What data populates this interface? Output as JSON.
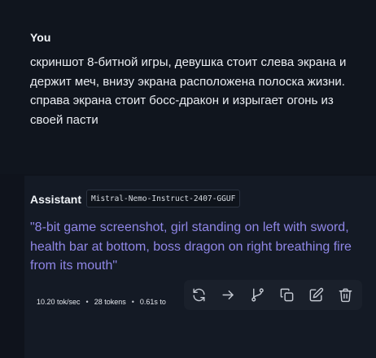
{
  "user": {
    "name": "You",
    "message": "скриншот 8-битной игры, девушка стоит слева экрана и держит меч, внизу экрана расположена полоска жизни. справа экрана стоит босс-дракон и изрыгает огонь из своей пасти"
  },
  "assistant": {
    "name": "Assistant",
    "model": "Mistral-Nemo-Instruct-2407-GGUF",
    "message": "\"8-bit game screenshot, girl standing on left with sword, health bar at bottom, boss dragon on right breathing fire from its mouth\""
  },
  "stats": {
    "speed": "10.20 tok/sec",
    "tokens": "28 tokens",
    "time": "0.61s to"
  },
  "toolbar": {
    "icons": [
      "regenerate-icon",
      "continue-icon",
      "branch-icon",
      "copy-icon",
      "edit-icon",
      "delete-icon"
    ]
  },
  "colors": {
    "background": "#0f131c",
    "assistant_panel": "#141a25",
    "assistant_text": "#8f86e6",
    "toolbar": "#1a202b"
  }
}
